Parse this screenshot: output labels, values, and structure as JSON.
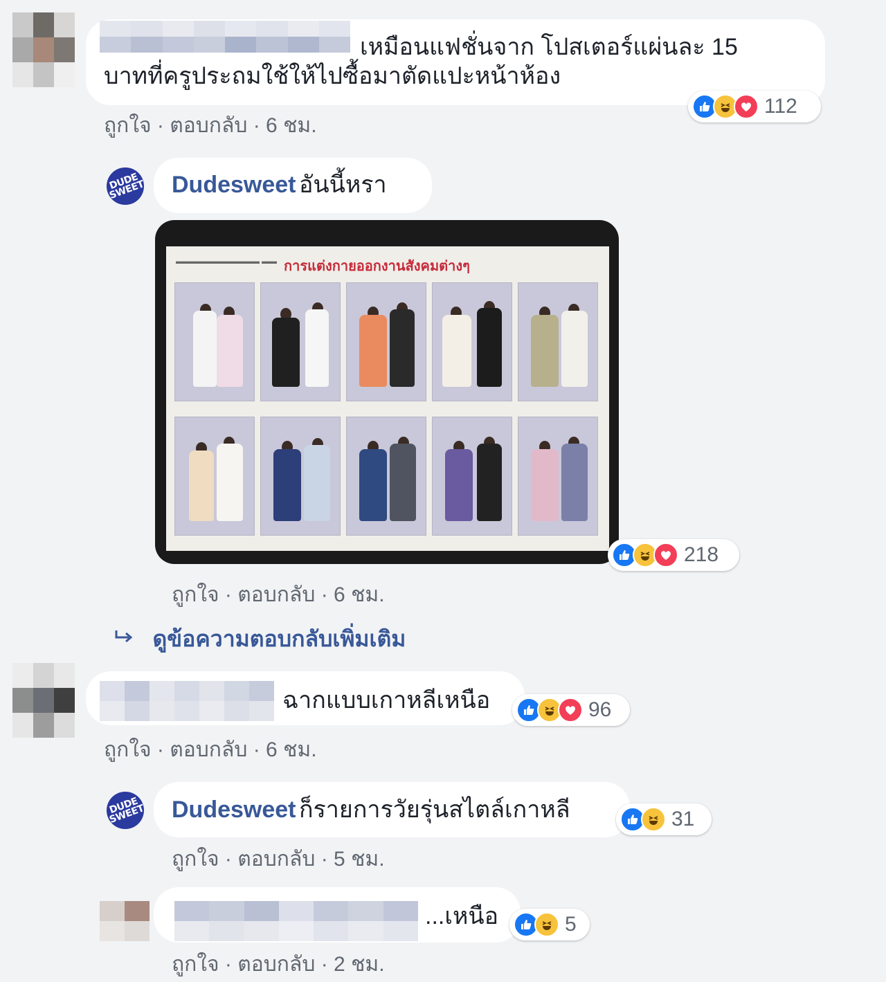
{
  "colors": {
    "background": "#f2f3f5",
    "bubble": "#ffffff",
    "link_name": "#385898",
    "meta_text": "#606770",
    "like_blue": "#1877f2",
    "haha_yellow": "#f7c23c",
    "love_red": "#f33e58"
  },
  "icons": [
    "like-icon",
    "haha-icon",
    "love-icon",
    "reply-arrow-icon"
  ],
  "comments": [
    {
      "text_line1": "เหมือนแฟชั่นจาก โปสเตอร์แผ่นละ 15",
      "text_line2": "บาทที่ครูประถมใช้ให้ไปซื้อมาตัดแปะหน้าห้อง",
      "reaction_count": "112",
      "like": "ถูกใจ",
      "reply": "ตอบกลับ",
      "time": "6 ชม."
    },
    {
      "author": "Dudesweet",
      "text": "อันนี้หรา",
      "avatar_text": "DUDE SWEET",
      "poster_title": "การแต่งกายออกงานสังคมต่างๆ",
      "reaction_count": "218",
      "like": "ถูกใจ",
      "reply": "ตอบกลับ",
      "time": "6 ชม.",
      "more_replies": "ดูข้อความตอบกลับเพิ่มเติม"
    },
    {
      "text": "ฉากแบบเกาหลีเหนือ",
      "reaction_count": "96",
      "like": "ถูกใจ",
      "reply": "ตอบกลับ",
      "time": "6 ชม."
    },
    {
      "author": "Dudesweet",
      "text": "ก็รายการวัยรุ่นสไตล์เกาหลี",
      "avatar_text": "DUDE SWEET",
      "reaction_count": "31",
      "like": "ถูกใจ",
      "reply": "ตอบกลับ",
      "time": "5 ชม."
    },
    {
      "text": "...เหนือ",
      "reaction_count": "5",
      "like": "ถูกใจ",
      "reply": "ตอบกลับ",
      "time": "2 ชม."
    }
  ]
}
